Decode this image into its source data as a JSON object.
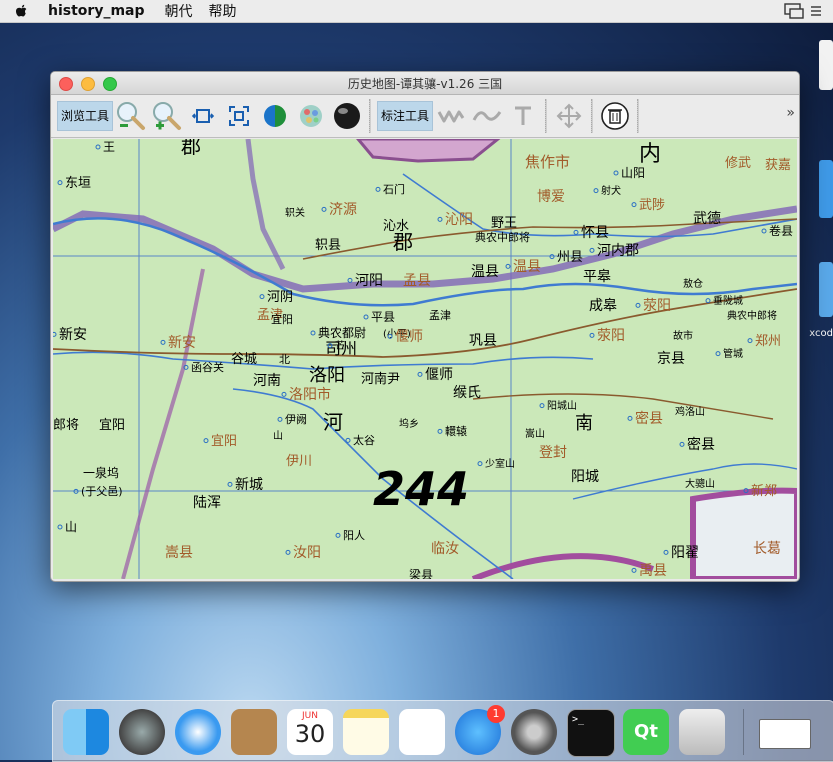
{
  "menubar": {
    "app_name": "history_map",
    "items": [
      "朝代",
      "帮助"
    ]
  },
  "window": {
    "title": "历史地图-谭其骧-v1.26  三国",
    "toolbar": {
      "browse_label": "浏览工具",
      "annotate_label": "标注工具",
      "browse_tools": [
        "zoom-out-icon",
        "zoom-in-icon",
        "fit-width-icon",
        "fit-all-icon",
        "half-globe-icon",
        "flower-globe-icon",
        "dark-globe-icon"
      ],
      "annotate_tools": [
        "wave-draw-icon",
        "curve-draw-icon",
        "text-tool-icon",
        "move-icon",
        "trash-icon"
      ],
      "overflow": "»"
    }
  },
  "map": {
    "place_labels": [
      {
        "text": "王"
      },
      {
        "text": "郡"
      },
      {
        "text": "内"
      },
      {
        "text": "修武"
      },
      {
        "text": "东垣"
      },
      {
        "text": "焦作市"
      },
      {
        "text": "山阳"
      },
      {
        "text": "获嘉"
      },
      {
        "text": "石门"
      },
      {
        "text": "博爱"
      },
      {
        "text": "射犬"
      },
      {
        "text": "轵关"
      },
      {
        "text": "济源"
      },
      {
        "text": "沁水"
      },
      {
        "text": "沁阳"
      },
      {
        "text": "野王"
      },
      {
        "text": "武陟"
      },
      {
        "text": "武德"
      },
      {
        "text": "卷县"
      },
      {
        "text": "典农中郎将"
      },
      {
        "text": "怀县"
      },
      {
        "text": "郡"
      },
      {
        "text": "河内郡"
      },
      {
        "text": "轵县"
      },
      {
        "text": "州县"
      },
      {
        "text": "温县"
      },
      {
        "text": "温县"
      },
      {
        "text": "平皋"
      },
      {
        "text": "河阳"
      },
      {
        "text": "孟县"
      },
      {
        "text": "河阴"
      },
      {
        "text": "成皋"
      },
      {
        "text": "荥阳"
      },
      {
        "text": "敖仓"
      },
      {
        "text": "垂陇城"
      },
      {
        "text": "孟津"
      },
      {
        "text": "平县"
      },
      {
        "text": "孟津"
      },
      {
        "text": "典农都尉"
      },
      {
        "text": "(小平)"
      },
      {
        "text": "新安"
      },
      {
        "text": "典农中郎将"
      },
      {
        "text": "新安"
      },
      {
        "text": "司州"
      },
      {
        "text": "偃师"
      },
      {
        "text": "巩县"
      },
      {
        "text": "荥阳"
      },
      {
        "text": "故市"
      },
      {
        "text": "郑州"
      },
      {
        "text": "谷城"
      },
      {
        "text": "函谷关"
      },
      {
        "text": "河南"
      },
      {
        "text": "洛阳"
      },
      {
        "text": "河南尹"
      },
      {
        "text": "偃师"
      },
      {
        "text": "京县"
      },
      {
        "text": "管城"
      },
      {
        "text": "缑氏"
      },
      {
        "text": "洛阳市"
      },
      {
        "text": "宜阳"
      },
      {
        "text": "伊阙"
      },
      {
        "text": "河"
      },
      {
        "text": "阳城山"
      },
      {
        "text": "南"
      },
      {
        "text": "密县"
      },
      {
        "text": "鸡洛山"
      },
      {
        "text": "太谷"
      },
      {
        "text": "坞乡"
      },
      {
        "text": "轘辕"
      },
      {
        "text": "嵩山"
      },
      {
        "text": "宜阳"
      },
      {
        "text": "登封"
      },
      {
        "text": "密县"
      },
      {
        "text": "一泉坞"
      },
      {
        "text": "(于父邑)"
      },
      {
        "text": "伊川"
      },
      {
        "text": "少室山"
      },
      {
        "text": "阳城"
      },
      {
        "text": "新城"
      },
      {
        "text": "大骢山"
      },
      {
        "text": "新郑"
      },
      {
        "text": "陆浑"
      },
      {
        "text": "阳人"
      },
      {
        "text": "嵩县"
      },
      {
        "text": "汝阳"
      },
      {
        "text": "临汝"
      },
      {
        "text": "阳翟"
      },
      {
        "text": "长葛"
      },
      {
        "text": "禹县"
      },
      {
        "text": "梁县"
      },
      {
        "text": "山"
      },
      {
        "text": "宜阳"
      },
      {
        "text": "郎将"
      },
      {
        "text": "北"
      },
      {
        "text": "芒"
      },
      {
        "text": "山"
      }
    ],
    "period_mark": "244"
  },
  "desktop": {
    "icon_label": "xcod"
  },
  "dock": {
    "apps": [
      "finder-icon",
      "launchpad-icon",
      "safari-icon",
      "contacts-icon",
      "calendar-icon",
      "notes-icon",
      "reminders-icon",
      "app-store-icon",
      "system-preferences-icon",
      "terminal-icon",
      "qt-creator-icon",
      "xcode-instruments-icon",
      "window-thumbnail-icon"
    ],
    "calendar_month": "JUN",
    "calendar_day": "30",
    "app_store_badge": "1",
    "qt_label": "Qt",
    "terminal_prompt": ">_"
  }
}
